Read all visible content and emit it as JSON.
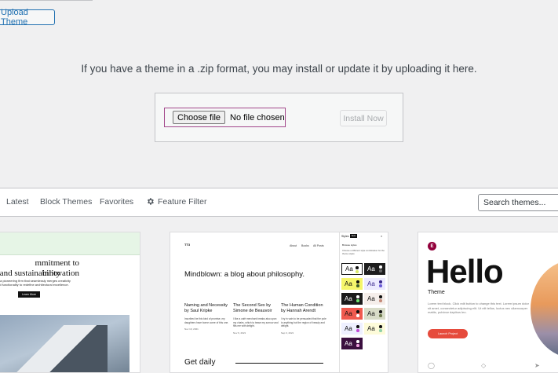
{
  "header": {
    "upload_theme_label": "Upload Theme"
  },
  "upload": {
    "help_text": "If you have a theme in a .zip format, you may install or update it by uploading it here.",
    "choose_file_label": "Choose file",
    "file_status": "No file chosen",
    "install_now_label": "Install Now"
  },
  "filters": {
    "latest": "Latest",
    "block_themes": "Block Themes",
    "favorites": "Favorites",
    "feature_filter": "Feature Filter",
    "search_placeholder": "Search themes..."
  },
  "themes": {
    "card1": {
      "heading_line1": "mmitment to innovation",
      "heading_line2": "and sustainability",
      "body": "s a pioneering firm that seamlessly merges creativity nd functionality to redefine architectural excellence.",
      "button": "Learn More"
    },
    "card2": {
      "logo": "TT3",
      "nav": [
        "About",
        "Books",
        "All Posts"
      ],
      "title": "Mindblown: a blog about philosophy.",
      "posts": [
        {
          "title": "Naming and Necessity by Saul Kripke",
          "excerpt": "Inscribed be this kind of promise, my daughters have borne come of this one.",
          "date": "Nov 10, 2021"
        },
        {
          "title": "The Second Sex by Simone de Beauvoir",
          "excerpt": "I like a café merchant breaks also upon my chairs, which to tease my sorrow and fills me with delight.",
          "date": "Nov 6, 2021"
        },
        {
          "title": "The Human Condition by Hannah Arendt",
          "excerpt": "I try in vain to be persuaded that the pole is anything but the region of beauty and delight.",
          "date": "Sep 3, 2021"
        }
      ],
      "get_daily": "Get daily",
      "panel": {
        "header": "Styles",
        "tag": "Beta",
        "close": "×",
        "subtitle": "Browse styles",
        "description": "Choose a different style combination for the theme styles",
        "swatch_label": "Aa"
      }
    },
    "card3": {
      "logo": "E",
      "title": "Hello",
      "subtitle": "Theme",
      "description": "Lorem text block. Click edit button to change this text. Lorem ipsum dolor sit amet, consectetur adipiscing elit. Ut elit tellus, luctus nec ullamcorper mattis, pulvinar dapibus leo.",
      "button": "Launch Project"
    }
  }
}
